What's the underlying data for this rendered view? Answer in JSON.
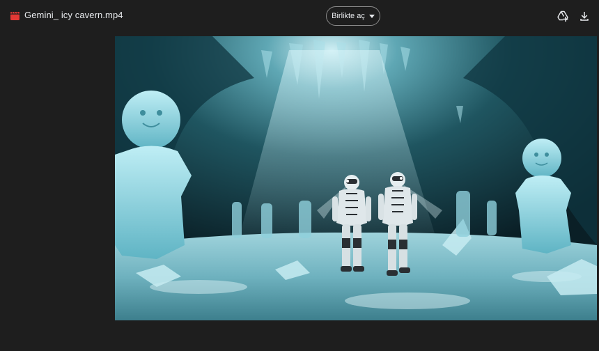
{
  "header": {
    "file_name": "Gemini_ icy cavern.mp4",
    "file_icon": "video-file-icon",
    "open_with_label": "Birlikte aç",
    "actions": [
      {
        "icon": "add-to-drive-icon"
      },
      {
        "icon": "download-icon"
      }
    ]
  },
  "viewer": {
    "content": "video-frame",
    "accent_color": "#4fb3c4"
  },
  "colors": {
    "background": "#1e1e1e",
    "text": "#e8eaed",
    "file_icon": "#e53935"
  }
}
